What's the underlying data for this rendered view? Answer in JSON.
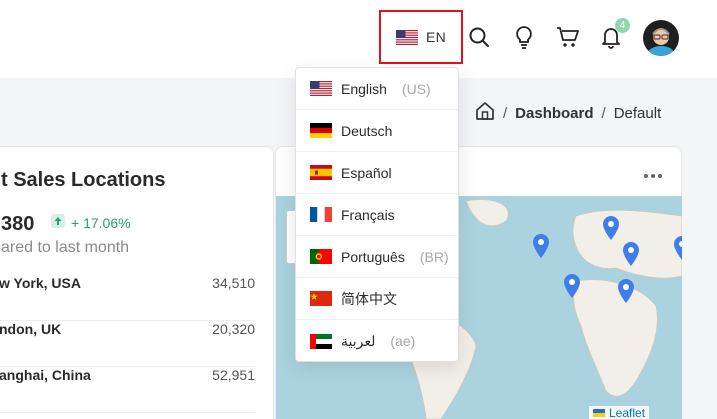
{
  "header": {
    "language_button": {
      "code": "EN",
      "flag": "us-flag"
    },
    "notification_count": "4",
    "icons": [
      "search-icon",
      "lightbulb-icon",
      "cart-icon",
      "bell-icon"
    ]
  },
  "breadcrumb": {
    "home_icon": "home-icon",
    "items": [
      "Dashboard",
      "Default"
    ],
    "separator": "/"
  },
  "language_menu": [
    {
      "label": "English",
      "sub": "(US)",
      "flag": "us"
    },
    {
      "label": "Deutsch",
      "sub": "",
      "flag": "de"
    },
    {
      "label": "Español",
      "sub": "",
      "flag": "es"
    },
    {
      "label": "Français",
      "sub": "",
      "flag": "fr"
    },
    {
      "label": "Português",
      "sub": "(BR)",
      "flag": "pt"
    },
    {
      "label": "简体中文",
      "sub": "",
      "flag": "cn"
    },
    {
      "label": "لعربية",
      "sub": "(ae)",
      "flag": "ae"
    }
  ],
  "sales_card": {
    "title": "t Sales Locations",
    "value": "380",
    "change": "+ 17.06%",
    "comparison": "ared to last month",
    "rows": [
      {
        "name": "w York, USA",
        "value": "34,510"
      },
      {
        "name": "ndon, UK",
        "value": "20,320"
      },
      {
        "name": "anghai, China",
        "value": "52,951"
      }
    ]
  },
  "map_card": {
    "attribution": "Leaflet"
  },
  "colors": {
    "highlight_border": "#e3111b",
    "positive": "#2aa168",
    "map_water": "#abd3df",
    "pin": "#3f7ee8"
  }
}
